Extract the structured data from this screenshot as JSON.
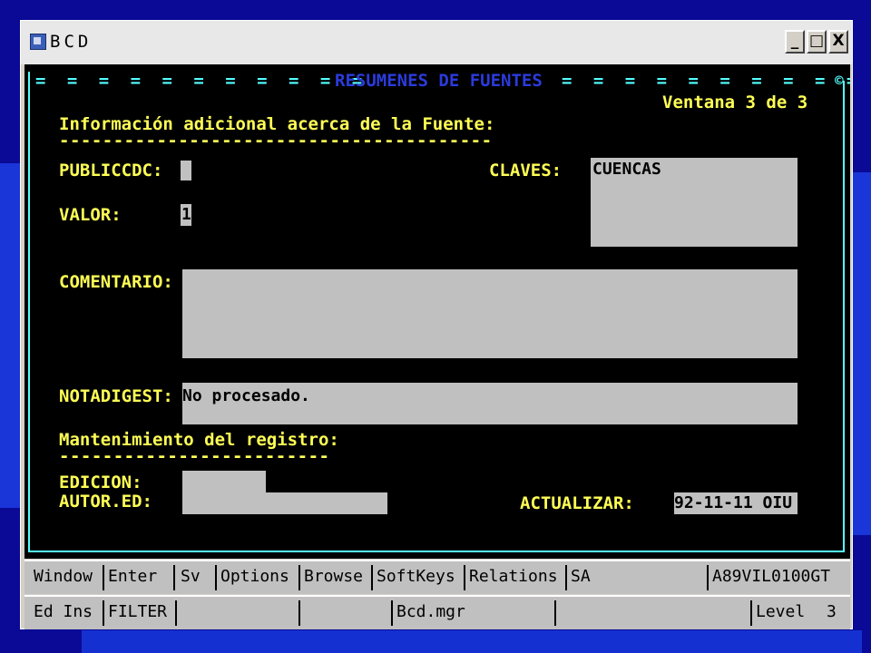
{
  "window": {
    "title": "BCD",
    "minimize_label": "_",
    "maximize_label": "□",
    "close_label": "X"
  },
  "terminal": {
    "header": "RESUMENES DE FUENTES",
    "header_left_dashes": "= = = = = = = = = = =",
    "header_right_dashes": "= = = = = = = = = =",
    "corner_mark": "©",
    "page_indicator": "Ventana 3 de 3",
    "section1_title": "Información adicional acerca de la Fuente:",
    "section1_rule": "----------------------------------------",
    "publiccdc_label": "PUBLICCDC:",
    "publiccdc_value": "",
    "claves_label": "CLAVES:",
    "claves_value": "CUENCAS",
    "valor_label": "VALOR:",
    "valor_value": "1",
    "comentario_label": "COMENTARIO:",
    "comentario_value": "",
    "notadigest_label": "NOTADIGEST:",
    "notadigest_value": "No procesado.",
    "section2_title": "Mantenimiento del registro:",
    "section2_rule": "-------------------------",
    "edicion_label": "EDICION:",
    "edicion_value": "",
    "autor_label": "AUTOR.ED:",
    "autor_value": "",
    "actualizar_label": "ACTUALIZAR:",
    "actualizar_value": "92-11-11 OIU"
  },
  "menubar": {
    "items": [
      "Window",
      "Enter",
      "Sv",
      "Options",
      "Browse",
      "SoftKeys",
      "Relations",
      "SA"
    ],
    "code": "A89VIL0100GT"
  },
  "statusbar": {
    "mode": "Ed Ins",
    "filter": "FILTER",
    "file": "Bcd.mgr",
    "level_label": "Level",
    "level_value": "3"
  },
  "colors": {
    "label": "#ffff55",
    "header": "#2b3bdc",
    "frame": "#55ffff",
    "field_bg": "#c0c0c0",
    "slide_bg": "#0a0a96"
  }
}
